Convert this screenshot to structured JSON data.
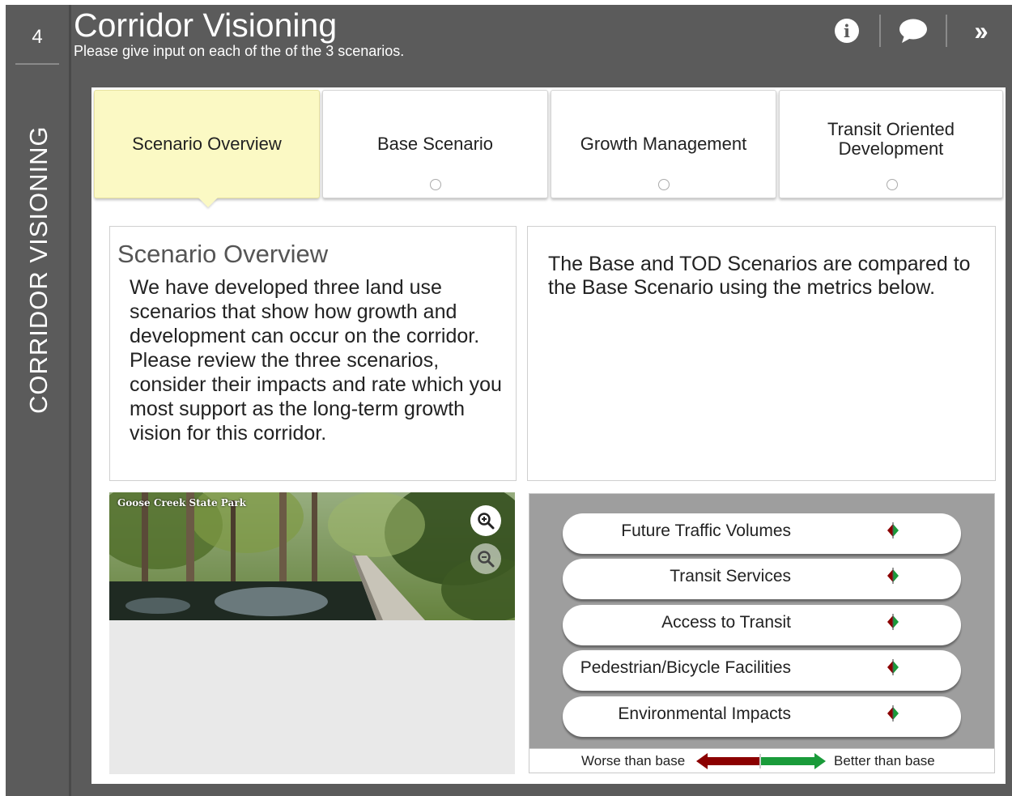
{
  "step": {
    "number": "4",
    "rail_title": "CORRIDOR VISIONING"
  },
  "header": {
    "title": "Corridor Visioning",
    "subtitle": "Please give input on each of the of the 3 scenarios."
  },
  "tabs": [
    {
      "label": "Scenario Overview",
      "active": true
    },
    {
      "label": "Base Scenario",
      "active": false
    },
    {
      "label": "Growth Management",
      "active": false
    },
    {
      "label": "Transit Oriented Development",
      "active": false
    }
  ],
  "overview": {
    "heading": "Scenario Overview",
    "text": "We have developed three land use scenarios that show how growth and development can occur on the corridor. Please review the three scenarios, consider their impacts and rate which you most support as the long-term growth vision for this corridor."
  },
  "comparison": {
    "text": "The Base and TOD Scenarios are compared to the Base Scenario using the metrics below."
  },
  "photo": {
    "caption": "Goose Creek State Park"
  },
  "metrics": [
    {
      "label": "Future Traffic Volumes"
    },
    {
      "label": "Transit Services"
    },
    {
      "label": "Access to Transit"
    },
    {
      "label": "Pedestrian/Bicycle Facilities"
    },
    {
      "label": "Environmental Impacts"
    }
  ],
  "legend": {
    "worse": "Worse than base",
    "better": "Better than base"
  },
  "colors": {
    "worse": "#8b0000",
    "better": "#1a9b3a",
    "active_tab": "#fbf9c4",
    "chrome": "#5b5b5b"
  },
  "icons": {
    "info": "info-icon",
    "comment": "comment-icon",
    "expand": "double-chevron-right-icon",
    "zoom_in": "zoom-in-icon",
    "zoom_out": "zoom-out-icon"
  }
}
